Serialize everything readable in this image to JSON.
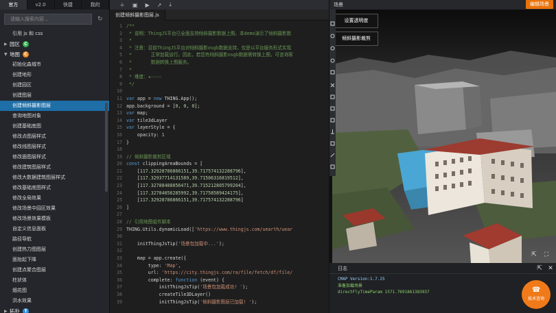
{
  "sidebar": {
    "tabs": [
      "官方",
      "v2.0",
      "快捷",
      "我的"
    ],
    "search_placeholder": "请输入搜索内容...",
    "items": [
      {
        "label": "引用 js 和 css",
        "type": "item"
      },
      {
        "label": "园区",
        "type": "group",
        "badge": "C",
        "badge_color": "#2fb24c"
      },
      {
        "label": "地图",
        "type": "group",
        "badge": "C",
        "badge_color": "#f08a24"
      },
      {
        "label": "初始化森城市",
        "type": "item"
      },
      {
        "label": "创建地形",
        "type": "item"
      },
      {
        "label": "创建园区",
        "type": "item"
      },
      {
        "label": "创建图层",
        "type": "item"
      },
      {
        "label": "创建倾斜摄影图层",
        "type": "item",
        "active": true
      },
      {
        "label": "查询地图对象",
        "type": "item"
      },
      {
        "label": "创建基础底图",
        "type": "item"
      },
      {
        "label": "修改点图层样式",
        "type": "item"
      },
      {
        "label": "修改线图层样式",
        "type": "item"
      },
      {
        "label": "修改面图层样式",
        "type": "item"
      },
      {
        "label": "修改建筑图层样式",
        "type": "item"
      },
      {
        "label": "修改大数据建筑图层样式",
        "type": "item"
      },
      {
        "label": "修改基础底图样式",
        "type": "item"
      },
      {
        "label": "修改全局效果",
        "type": "item"
      },
      {
        "label": "修改场景中园区效果",
        "type": "item"
      },
      {
        "label": "修改场景效果模板",
        "type": "item"
      },
      {
        "label": "自定义信息面板",
        "type": "item"
      },
      {
        "label": "路径导航",
        "type": "item"
      },
      {
        "label": "创建热力图图层",
        "type": "item"
      },
      {
        "label": "面抬起下降",
        "type": "item"
      },
      {
        "label": "创建点聚合图层",
        "type": "item"
      },
      {
        "label": "柱状体",
        "type": "item"
      },
      {
        "label": "烟花图",
        "type": "item"
      },
      {
        "label": "洪水效果",
        "type": "item"
      },
      {
        "label": "拓扑",
        "type": "group",
        "badge": "T",
        "badge_color": "#2f8fe0"
      }
    ]
  },
  "editor": {
    "file_tab": "创建倾斜摄影图层.js",
    "lines": [
      "/**",
      " * 说明：ThingJS平台已全面支持倾斜摄影数据上图。本demo演示了倾斜摄影数",
      " *",
      " * 注意：目前ThingJS平台对倾斜摄影osgb数据支持，仅是以平台服务形式实现",
      " *       正常加载运行。因此，若您有倾斜摄影osgb数据需转换上图，可咨询客",
      " *       数据转换上图服务。",
      " *",
      " * 难度：★☆☆☆☆",
      " */",
      "",
      "var app = new THING.App();",
      "app.background = [0, 0, 0];",
      "var map;",
      "var tile3dLayer",
      "var layerStyle = {",
      "    opacity: 1",
      "}",
      "",
      "// 倾斜摄影裁剪区域",
      "const clippingAreaBounds = [",
      "    [117.32928786866151,39.717574132288796],",
      "    [117.32937714131589,39.71506316819512],",
      "    [117.32788408056471,39.715212805799204],",
      "    [117.32784056285992,39.71758589424175],",
      "    [117.32928786866151,39.717574132288796]",
      "]",
      "",
      "// 引用地图组件脚本",
      "THING.Utils.dynamicLoad(['https://www.thingjs.com/uearth/uear",
      "",
      "    initThingJsTip('场景包加载中...');",
      "",
      "    map = app.create({",
      "        type: 'Map',",
      "        url: 'https://city.thingjs.com/ra/file/fetch/df/file/",
      "        complete: function (event) {",
      "            initThingJsTip('场景包加载成功! ');",
      "            createTile3DLayer()",
      "            initThingJsTip('倾斜摄影图层已加载! ');"
    ]
  },
  "preview": {
    "title": "场景",
    "edit_button": "编辑场景",
    "buttons": [
      "设置透明度",
      "倾斜摄影裁剪"
    ],
    "log_title": "日志",
    "log_lines": [
      "CMAP Version:1.7.25",
      "准备加载场景",
      "directFlyTimeParam 1571.7691861383937"
    ],
    "support_label": "技术咨询"
  },
  "colors": {
    "accent": "#1e6ea7",
    "orange": "#e8730b",
    "log_green": "#8fd36a"
  }
}
